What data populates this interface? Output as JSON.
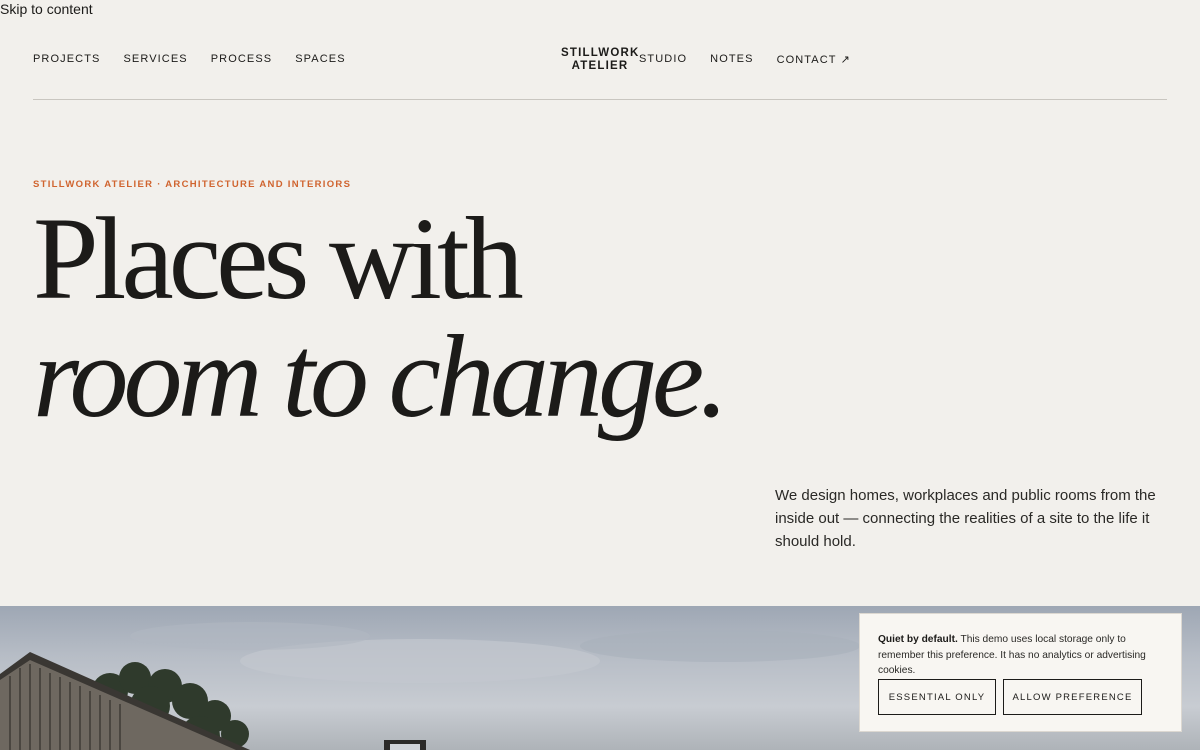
{
  "skip_link": "Skip to content",
  "nav": {
    "left": [
      "PROJECTS",
      "SERVICES",
      "PROCESS",
      "SPACES"
    ],
    "brand_line1": "STILLWORK",
    "brand_line2": "ATELIER",
    "right": [
      "STUDIO",
      "NOTES",
      "CONTACT ↗"
    ]
  },
  "hero": {
    "eyebrow": "STILLWORK ATELIER · ARCHITECTURE AND INTERIORS",
    "headline_line1": "Places with",
    "headline_line2": "room to change.",
    "intro": "We design homes, workplaces and public rooms from the inside out — connecting the realities of a site to the life it should hold."
  },
  "cookie": {
    "title": "Quiet by default.",
    "body": "This demo uses local storage only to remember this preference. It has no analytics or advertising cookies.",
    "essential_label": "ESSENTIAL ONLY",
    "allow_label": "ALLOW PREFERENCE"
  },
  "colors": {
    "background": "#f2f0ec",
    "accent": "#d0642f",
    "text": "#1c1b19"
  }
}
